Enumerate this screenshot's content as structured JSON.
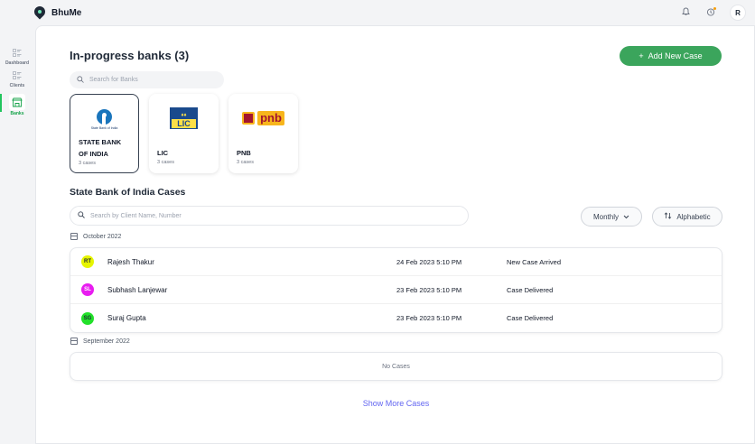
{
  "app": {
    "brand": "BhuMe",
    "avatar_initial": "R"
  },
  "sidebar": {
    "items": [
      {
        "label": "Dashboard",
        "icon": "dashboard-icon"
      },
      {
        "label": "Clients",
        "icon": "clients-icon"
      },
      {
        "label": "Banks",
        "icon": "bank-icon",
        "active": true
      }
    ]
  },
  "header": {
    "title": "In-progress banks (3)",
    "add_button": "Add New Case",
    "bank_search_placeholder": "Search for Banks"
  },
  "banks": [
    {
      "name_line1": "STATE BANK",
      "name_line2": "OF INDIA",
      "count": "3 cases",
      "logo_text": "State Bank of India",
      "selected": true
    },
    {
      "name_line1": "LIC",
      "count": "3 cases",
      "logo_text": "LIC"
    },
    {
      "name_line1": "PNB",
      "count": "3 cases",
      "logo_text": "pnb"
    }
  ],
  "cases_section": {
    "title": "State Bank of India Cases",
    "search_placeholder": "Search by Client Name, Number",
    "filter_monthly": "Monthly",
    "sort_label": "Alphabetic",
    "groups": [
      {
        "month": "October 2022",
        "rows": [
          {
            "initials": "RT",
            "name": "Rajesh Thakur",
            "date": "24 Feb 2023 5:10 PM",
            "status": "New Case Arrived",
            "color": "#e6f500"
          },
          {
            "initials": "SL",
            "name": "Subhash Lanjewar",
            "date": "23 Feb 2023 5:10 PM",
            "status": "Case Delivered",
            "color": "#e81cf0"
          },
          {
            "initials": "SG",
            "name": "Suraj Gupta",
            "date": "23 Feb 2023 5:10 PM",
            "status": "Case Delivered",
            "color": "#22e02a"
          }
        ]
      },
      {
        "month": "September 2022",
        "empty_text": "No Cases"
      }
    ],
    "show_more": "Show More Cases"
  },
  "colors": {
    "accent": "#3ba55c",
    "link": "#6366f1"
  }
}
